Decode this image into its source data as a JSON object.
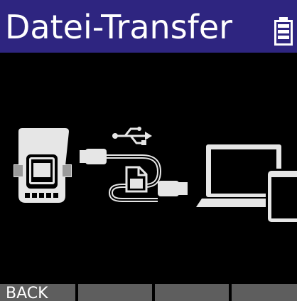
{
  "header": {
    "title": "Datei-Transfer",
    "battery_icon": "battery-icon"
  },
  "illustration": {
    "icons": [
      "recorder-device-icon",
      "usb-cable-icon",
      "usb-symbol-icon",
      "file-icon",
      "laptop-icon",
      "tablet-icon"
    ]
  },
  "function_keys": [
    {
      "label": "BACK"
    },
    {
      "label": ""
    },
    {
      "label": ""
    },
    {
      "label": ""
    }
  ],
  "colors": {
    "title_bar": "#2e2580",
    "background": "#000000",
    "function_key": "#5e5e5e",
    "icon_fill": "#e6e6e6",
    "text": "#ffffff"
  }
}
